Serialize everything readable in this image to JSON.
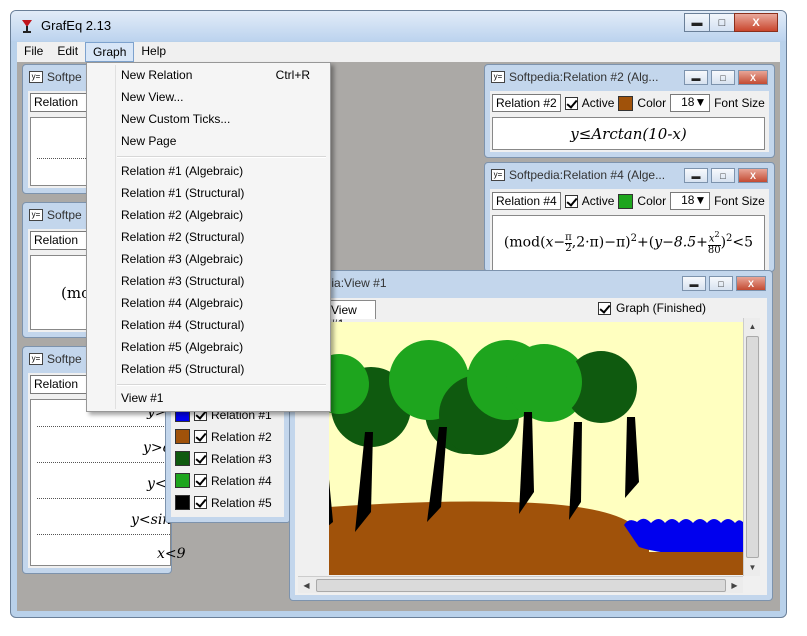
{
  "app": {
    "title": "GrafEq 2.13",
    "caption": {
      "minimize": "▬",
      "maximize": "□",
      "close": "X"
    }
  },
  "menubar": {
    "items": [
      {
        "label": "File"
      },
      {
        "label": "Edit"
      },
      {
        "label": "Graph"
      },
      {
        "label": "Help"
      }
    ]
  },
  "graph_menu": {
    "items": [
      {
        "label": "New Relation",
        "shortcut": "Ctrl+R"
      },
      {
        "label": "New View..."
      },
      {
        "label": "New Custom Ticks..."
      },
      {
        "label": "New Page"
      },
      {
        "label": "Relation #1 (Algebraic)"
      },
      {
        "label": "Relation #1 (Structural)"
      },
      {
        "label": "Relation #2 (Algebraic)"
      },
      {
        "label": "Relation #2 (Structural)"
      },
      {
        "label": "Relation #3 (Algebraic)"
      },
      {
        "label": "Relation #3 (Structural)"
      },
      {
        "label": "Relation #4 (Algebraic)"
      },
      {
        "label": "Relation #4 (Structural)"
      },
      {
        "label": "Relation #5 (Algebraic)"
      },
      {
        "label": "Relation #5 (Structural)"
      },
      {
        "label": "View #1"
      }
    ]
  },
  "left_windows": [
    {
      "title": "Softpe",
      "relation": "Relation #"
    },
    {
      "title": "Softpe",
      "relation": "Relation #",
      "formula": "(mo"
    },
    {
      "title": "Softpe",
      "relation": "Relation #",
      "lines": [
        "y>",
        "y>c",
        "y<",
        "y<sin",
        "x<9"
      ]
    }
  ],
  "relation2": {
    "title": "Softpedia:Relation #2 (Alg...",
    "label": "Relation #2",
    "active": "Active",
    "color_label": "Color",
    "color": "#a0520a",
    "font_size": "18▼",
    "font_size_label": "Font Size",
    "formula": "y≤Arctan(10-x)"
  },
  "relation4": {
    "title": "Softpedia:Relation #4 (Alge...",
    "label": "Relation #4",
    "active": "Active",
    "color_label": "Color",
    "color": "#1ea51e",
    "font_size": "18▼",
    "font_size_label": "Font Size",
    "formula_parts": {
      "mod": "mod",
      "x_minus": "x−",
      "pi": "π",
      "two": "2",
      "comma": ",2·π)−π)",
      "sq": "2",
      "plus": "+",
      "y_part": "y−8.5+",
      "x2": "x",
      "x2sq": "2",
      "eighty": "80",
      "lt5": "<5"
    }
  },
  "legend": {
    "rows": [
      {
        "label": "Relation #1",
        "color": "#0000ee"
      },
      {
        "label": "Relation #2",
        "color": "#a0520a"
      },
      {
        "label": "Relation #3",
        "color": "#0f5a0f"
      },
      {
        "label": "Relation #4",
        "color": "#1ea51e"
      },
      {
        "label": "Relation #5",
        "color": "#000000"
      }
    ]
  },
  "view1": {
    "title": "Softpedia:View #1",
    "tab": "View #1",
    "status": "Graph (Finished)",
    "colors": {
      "sky": "#ffffc0",
      "ground": "#a0520a",
      "tree_dark": "#0f5a0f",
      "tree_light": "#1ea51e",
      "trunk": "#000000",
      "water": "#0000ee"
    }
  }
}
